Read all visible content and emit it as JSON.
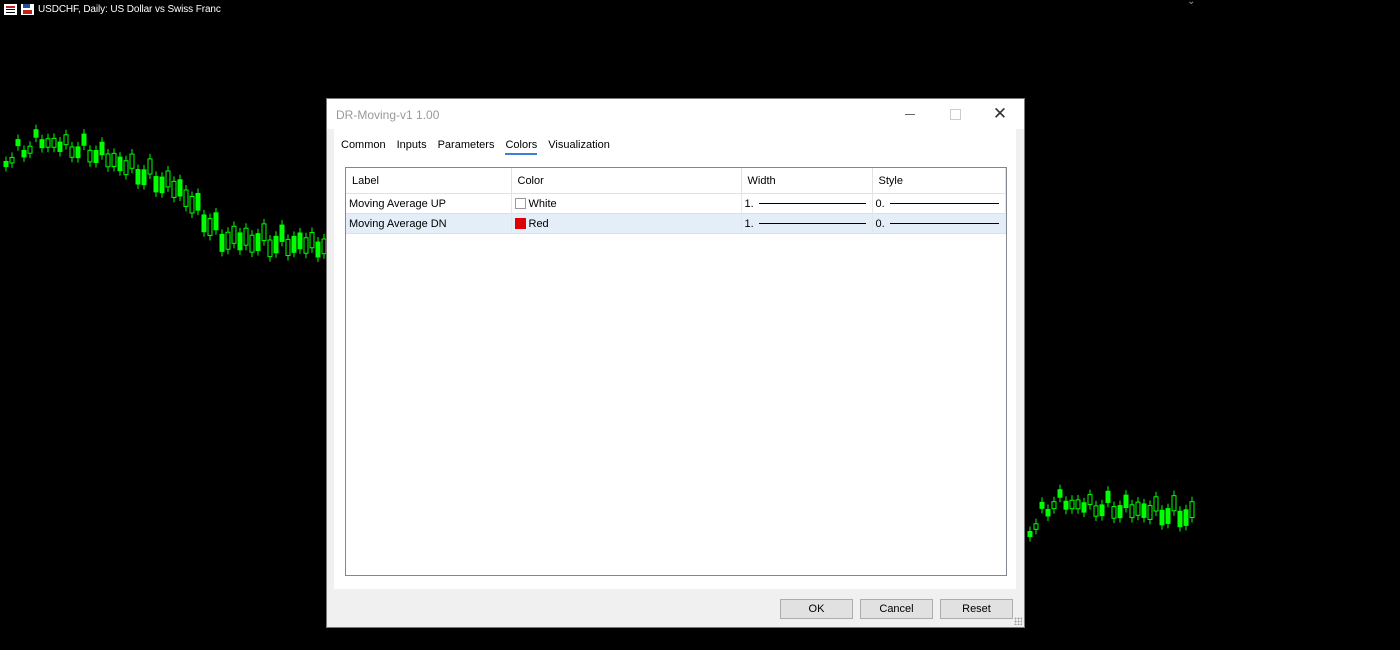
{
  "chart": {
    "symbol_text": "USDCHF, Daily:  US Dollar vs Swiss Franc",
    "candle_color": "#00ff00",
    "background": "#000000"
  },
  "dialog": {
    "title": "DR-Moving-v1 1.00",
    "tabs": [
      {
        "label": "Common",
        "active": false
      },
      {
        "label": "Inputs",
        "active": false
      },
      {
        "label": "Parameters",
        "active": false
      },
      {
        "label": "Colors",
        "active": true
      },
      {
        "label": "Visualization",
        "active": false
      }
    ],
    "columns": [
      "Label",
      "Color",
      "Width",
      "Style"
    ],
    "rows": [
      {
        "label": "Moving Average UP",
        "color_name": "White",
        "color": "#ffffff",
        "width": "1.",
        "style": "0."
      },
      {
        "label": "Moving Average DN",
        "color_name": "Red",
        "color": "#e00000",
        "width": "1.",
        "style": "0."
      }
    ],
    "buttons": {
      "ok": "OK",
      "cancel": "Cancel",
      "reset": "Reset"
    }
  }
}
